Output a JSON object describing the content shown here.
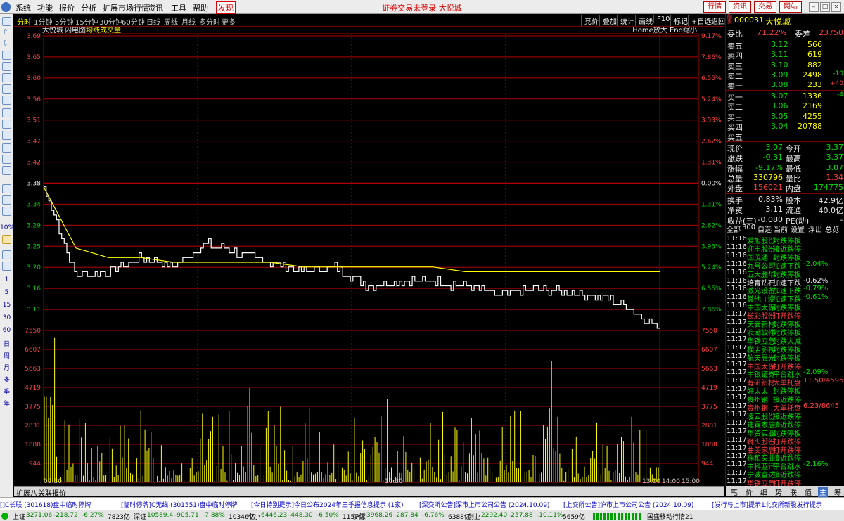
{
  "menu": {
    "items": [
      "系统",
      "功能",
      "报价",
      "分析",
      "扩展市场行情",
      "资讯",
      "工具",
      "帮助"
    ],
    "hot": "发现",
    "title": "证券交易未登录  大悦城",
    "quick": [
      "行情",
      "资讯",
      "交易",
      "网站"
    ]
  },
  "left_toolbar": {
    "labels": [
      "1",
      "5",
      "15",
      "30",
      "60",
      "日",
      "周",
      "月",
      "多",
      "季",
      "年"
    ],
    "zoom": "10%"
  },
  "period": {
    "tabs": [
      "分时",
      "1分钟",
      "5分钟",
      "15分钟",
      "30分钟",
      "60分钟",
      "日线",
      "周线",
      "月线",
      "多分时",
      "更多"
    ],
    "active": 0,
    "right": [
      "竞价",
      "叠加",
      "统计",
      "画线",
      "F10",
      "标记",
      "+自选",
      "返回"
    ]
  },
  "chart": {
    "name": "大悦城",
    "legend": [
      "闪电图",
      "均线",
      "成交量"
    ],
    "hint": "Home放大 End缩小",
    "colors": {
      "price": "#ffffff",
      "avg": "#ffff00",
      "volume": "#ffff00",
      "grid": "#b00000"
    }
  },
  "chart_data": {
    "type": "line",
    "title": "大悦城",
    "x": [
      "09:30",
      "10:30",
      "13:00",
      "14:00",
      "15:00"
    ],
    "price_ticks_left": [
      "3.69",
      "3.65",
      "3.60",
      "3.56",
      "3.51",
      "3.47",
      "3.42",
      "3.38",
      "3.34",
      "3.29",
      "3.25",
      "3.20",
      "3.16",
      "3.11"
    ],
    "price_ticks_right": [
      "9.17%",
      "7.86%",
      "6.55%",
      "5.24%",
      "3.93%",
      "2.62%",
      "1.31%",
      "0.00%",
      "1.31%",
      "2.62%",
      "3.93%",
      "5.24%",
      "6.55%",
      "7.86%"
    ],
    "volume_ticks": [
      "7550",
      "6607",
      "5663",
      "4719",
      "3775",
      "2831",
      "1888",
      "944"
    ],
    "ylim": [
      3.07,
      3.69
    ],
    "prev_close": 3.38,
    "series": [
      {
        "name": "均线",
        "values": [
          3.37,
          3.24,
          3.22,
          3.22,
          3.21,
          3.21,
          3.21,
          3.21,
          3.2,
          3.2,
          3.2,
          3.2,
          3.2,
          3.19,
          3.19,
          3.19,
          3.19,
          3.19,
          3.19,
          3.19
        ]
      },
      {
        "values": [
          3.37,
          3.18,
          3.19,
          3.22,
          3.2,
          3.25,
          3.23,
          3.21,
          3.19,
          3.2,
          3.16,
          3.17,
          3.17,
          3.16,
          3.14,
          3.15,
          3.15,
          3.14,
          3.12,
          3.07
        ]
      }
    ],
    "volume_peak": 7550
  },
  "bottom_tabs": [
    "扩展八",
    "关联报价"
  ],
  "quote": {
    "code": "000031",
    "name": "大悦城",
    "weibi_label": "委比",
    "weibi": "71.22%",
    "weicha_label": "委差",
    "weicha": "23750",
    "asks": [
      {
        "label": "卖五",
        "price": "3.12",
        "vol": "566",
        "chg": ""
      },
      {
        "label": "卖四",
        "price": "3.11",
        "vol": "619",
        "chg": ""
      },
      {
        "label": "卖三",
        "price": "3.10",
        "vol": "882",
        "chg": ""
      },
      {
        "label": "卖二",
        "price": "3.09",
        "vol": "2498",
        "chg": "-10"
      },
      {
        "label": "卖一",
        "price": "3.08",
        "vol": "233",
        "chg": "+40"
      }
    ],
    "bids": [
      {
        "label": "买一",
        "price": "3.07",
        "vol": "1336",
        "chg": "-4"
      },
      {
        "label": "买二",
        "price": "3.06",
        "vol": "2169",
        "chg": ""
      },
      {
        "label": "买三",
        "price": "3.05",
        "vol": "4255",
        "chg": ""
      },
      {
        "label": "买四",
        "price": "3.04",
        "vol": "20788",
        "chg": ""
      },
      {
        "label": "买五",
        "price": "",
        "vol": "",
        "chg": ""
      }
    ],
    "stats": [
      {
        "l1": "现价",
        "v1": "3.07",
        "l2": "今开",
        "v2": "3.37",
        "c1": "green",
        "c2": "green"
      },
      {
        "l1": "涨跌",
        "v1": "-0.31",
        "l2": "最高",
        "v2": "3.37",
        "c1": "green",
        "c2": "green"
      },
      {
        "l1": "涨幅",
        "v1": "-9.17%",
        "l2": "最低",
        "v2": "3.07",
        "c1": "green",
        "c2": "green"
      },
      {
        "l1": "总量",
        "v1": "330796",
        "l2": "量比",
        "v2": "1.34",
        "c1": "yellow",
        "c2": "red"
      },
      {
        "l1": "外盘",
        "v1": "156021",
        "l2": "内盘",
        "v2": "174775",
        "c1": "red",
        "c2": "green"
      }
    ],
    "stats2": [
      {
        "l1": "换手",
        "v1": "0.83%",
        "l2": "股本",
        "v2": "42.9亿"
      },
      {
        "l1": "净资",
        "v1": "3.11",
        "l2": "流通",
        "v2": "40.0亿"
      },
      {
        "l1": "收益(三)",
        "v1": "-0.080",
        "l2": "PE(动)",
        "v2": "–"
      }
    ]
  },
  "trade_filter": [
    "全部",
    "300",
    "自选",
    "当前",
    "设置",
    "浮出",
    "总览"
  ],
  "trades": [
    {
      "t": "11:16",
      "n": "爱旭股份",
      "a": "封跌停板",
      "v": "",
      "c": "green"
    },
    {
      "t": "11:16",
      "n": "迎丰股份",
      "a": "接近跌停",
      "v": "",
      "c": "green"
    },
    {
      "t": "11:16",
      "n": "国茂通",
      "a": "封跌停板",
      "v": "",
      "c": "green"
    },
    {
      "t": "11:16",
      "n": "九号公司",
      "a": "加速下跌",
      "v": "-2.04%",
      "c": "green"
    },
    {
      "t": "11:16",
      "n": "五大胜华",
      "a": "封跌停板",
      "v": "",
      "c": "green"
    },
    {
      "t": "11:16",
      "n": "培育钻石",
      "a": "加速下跌",
      "v": "-0.62%",
      "c": "white"
    },
    {
      "t": "11:16",
      "n": "激光设备",
      "a": "加速下跌",
      "v": "-0.79%",
      "c": "green"
    },
    {
      "t": "11:16",
      "n": "其他IT设",
      "a": "加速下跌",
      "v": "-0.61%",
      "c": "green"
    },
    {
      "t": "11:16",
      "n": "中国太保",
      "a": "封跌停板",
      "v": "",
      "c": "green"
    },
    {
      "t": "11:17",
      "n": "长彩股份",
      "a": "打开跌停",
      "v": "",
      "c": "red"
    },
    {
      "t": "11:17",
      "n": "天安新材",
      "a": "封跌停板",
      "v": "",
      "c": "green"
    },
    {
      "t": "11:17",
      "n": "浪潮软件",
      "a": "封跌停板",
      "v": "",
      "c": "green"
    },
    {
      "t": "11:17",
      "n": "华铁应急",
      "a": "封跌大减",
      "v": "",
      "c": "green"
    },
    {
      "t": "11:17",
      "n": "横店影视",
      "a": "封跌停板",
      "v": "",
      "c": "green"
    },
    {
      "t": "11:17",
      "n": "航天晨光",
      "a": "封跌停板",
      "v": "",
      "c": "green"
    },
    {
      "t": "11:17",
      "n": "中国太保",
      "a": "打开跌停",
      "v": "",
      "c": "red"
    },
    {
      "t": "11:17",
      "n": "中银证券",
      "a": "平台跳水",
      "v": "-2.09%",
      "c": "green"
    },
    {
      "t": "11:17",
      "n": "有研新材",
      "a": "大单托盘",
      "v": "11.50/4595",
      "c": "red"
    },
    {
      "t": "11:17",
      "n": "好太太",
      "a": "封跌停板",
      "v": "",
      "c": "green"
    },
    {
      "t": "11:17",
      "n": "贵州钢",
      "a": "接近跌停",
      "v": "",
      "c": "green"
    },
    {
      "t": "11:17",
      "n": "贵州钢",
      "a": "大单托盘",
      "v": "6.23/8645",
      "c": "red"
    },
    {
      "t": "11:17",
      "n": "凌云股份",
      "a": "接近跌停",
      "v": "",
      "c": "green"
    },
    {
      "t": "11:17",
      "n": "建霖家居",
      "a": "接近跌停",
      "v": "",
      "c": "green"
    },
    {
      "t": "11:17",
      "n": "华资实业",
      "a": "封跌停板",
      "v": "",
      "c": "green"
    },
    {
      "t": "11:17",
      "n": "狮头股份",
      "a": "打开跌停",
      "v": "",
      "c": "red"
    },
    {
      "t": "11:17",
      "n": "曲美家居",
      "a": "打开跌停",
      "v": "",
      "c": "red"
    },
    {
      "t": "11:17",
      "n": "祥和实业",
      "a": "接近跌停",
      "v": "",
      "c": "green"
    },
    {
      "t": "11:17",
      "n": "中科蓝讯",
      "a": "平台跳水",
      "v": "-2.16%",
      "c": "green"
    },
    {
      "t": "11:17",
      "n": "宁波富达",
      "a": "接近跌停",
      "v": "",
      "c": "green"
    },
    {
      "t": "11:17",
      "n": "华铁应急",
      "a": "打开跌停",
      "v": "",
      "c": "red"
    }
  ],
  "right_tabs": [
    "笔",
    "价",
    "细",
    "势",
    "联",
    "值",
    "主",
    "筹"
  ],
  "ticker": [
    "[]C长联 (301618)盘中临时停牌",
    "[临时停牌]C无线 (301551)盘中临时停牌",
    "[今日特别提示]今日公布2024年三季报信息提示 (1家)",
    "[深交所公告]深市上市公司公告 (2024.10.09)",
    "[上交所公告]沪市上市公司公告 (2024.10.09)",
    "[发行与上市]提示1北交所新股发行提示"
  ],
  "status": [
    {
      "name": "上证",
      "val": "3271.06",
      "chg": "-218.72",
      "pct": "-6.27%",
      "amt": "7823亿"
    },
    {
      "name": "深证",
      "val": "10589.4",
      "chg": "-905.71",
      "pct": "-7.88%",
      "amt": "10346亿"
    },
    {
      "name": "中小",
      "val": "6446.23",
      "chg": "-448.30",
      "pct": "-6.50%",
      "amt": "1157亿"
    },
    {
      "name": "沪深",
      "val": "3968.26",
      "chg": "-287.84",
      "pct": "-6.76%",
      "amt": "6388亿"
    },
    {
      "name": "创业",
      "val": "2292.40",
      "chg": "-257.88",
      "pct": "-10.11%",
      "amt": "5659亿"
    }
  ],
  "status_right": "国盛移动行情21"
}
